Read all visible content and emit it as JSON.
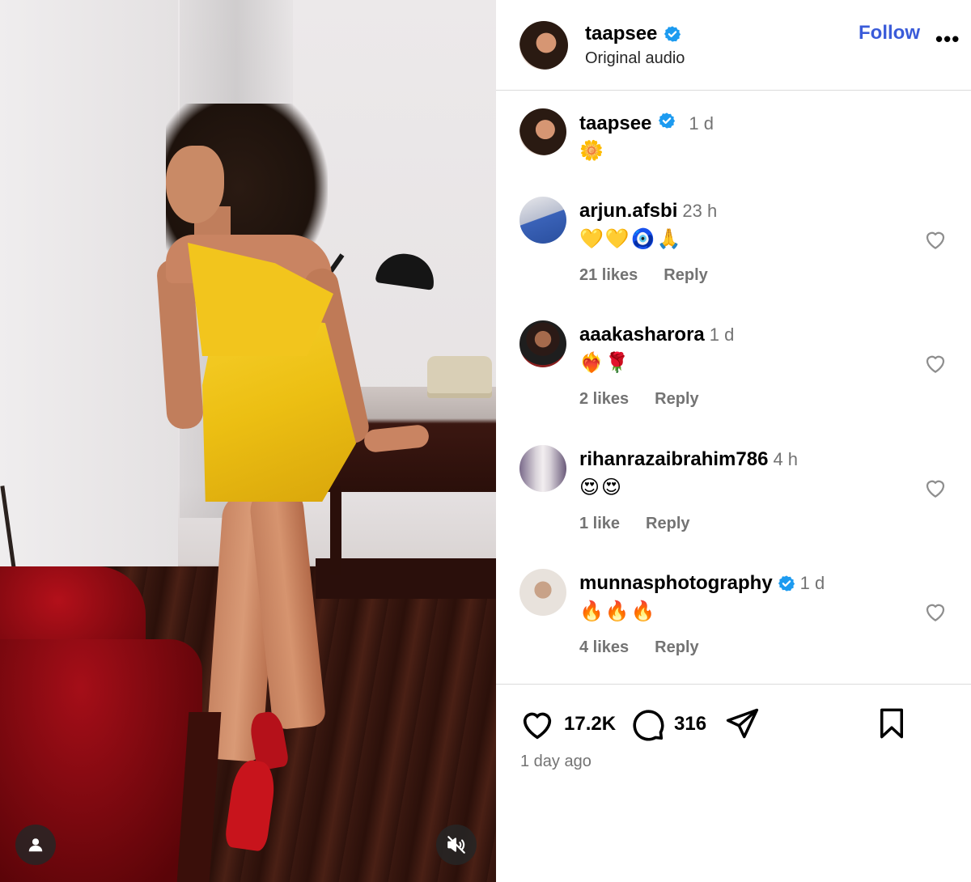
{
  "post": {
    "author": "taapsee",
    "subtitle": "Original audio",
    "follow_label": "Follow",
    "more_label": "•••",
    "verified": true,
    "brand_color": "#3a5bd9"
  },
  "caption": {
    "username": "taapsee",
    "time": "1 d",
    "text": "🌼"
  },
  "comments": [
    {
      "username": "arjun.afsbi",
      "verified": false,
      "time": "23 h",
      "text": "💛💛🧿🙏",
      "likes": "21 likes",
      "reply": "Reply"
    },
    {
      "username": "aaakasharora",
      "verified": false,
      "time": "1 d",
      "text": "❤️‍🔥🌹",
      "likes": "2 likes",
      "reply": "Reply"
    },
    {
      "username": "rihanrazaibrahim786",
      "verified": false,
      "time": "4 h",
      "text": "😍😍",
      "likes": "1 like",
      "reply": "Reply"
    },
    {
      "username": "munnasphotography",
      "verified": true,
      "time": "1 d",
      "text": "🔥🔥🔥",
      "likes": "4 likes",
      "reply": "Reply"
    }
  ],
  "stats": {
    "likes": "17.2K",
    "comments": "316",
    "posted": "1 day ago"
  },
  "icons": {
    "like": "heart-icon",
    "comment": "comment-icon",
    "share": "share-icon",
    "save": "bookmark-icon",
    "user_tag": "user-icon",
    "mute": "mute-icon"
  }
}
